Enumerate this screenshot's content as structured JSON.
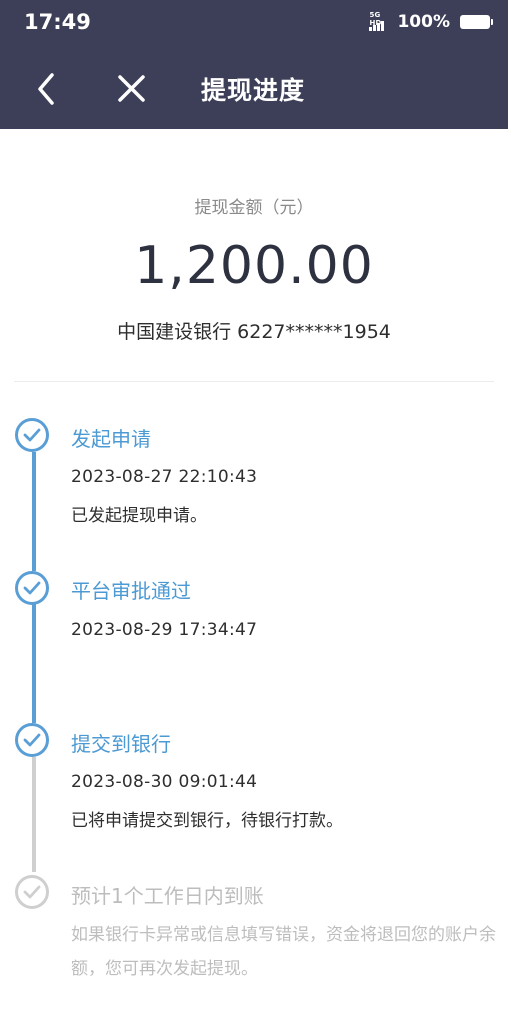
{
  "status_bar": {
    "time": "17:49",
    "network": "5G HD",
    "battery": "100%"
  },
  "nav": {
    "title": "提现进度",
    "back_icon": "chevron-left-icon",
    "close_icon": "close-icon"
  },
  "summary": {
    "amount_label": "提现金额（元）",
    "amount": "1,200.00",
    "bank": "中国建设银行 6227******1954"
  },
  "colors": {
    "header_bg": "#3c3f57",
    "accent": "#5a9ed6",
    "pending": "#cfcfcf"
  },
  "steps": [
    {
      "title": "发起申请",
      "time": "2023-08-27 22:10:43",
      "desc": "已发起提现申请。",
      "status": "done"
    },
    {
      "title": "平台审批通过",
      "time": "2023-08-29 17:34:47",
      "desc": "",
      "status": "done"
    },
    {
      "title": "提交到银行",
      "time": "2023-08-30 09:01:44",
      "desc": "已将申请提交到银行，待银行打款。",
      "status": "done"
    },
    {
      "title": "预计1个工作日内到账",
      "time": "",
      "desc": "如果银行卡异常或信息填写错误，资金将退回您的账户余额，您可再次发起提现。",
      "status": "pending"
    }
  ]
}
